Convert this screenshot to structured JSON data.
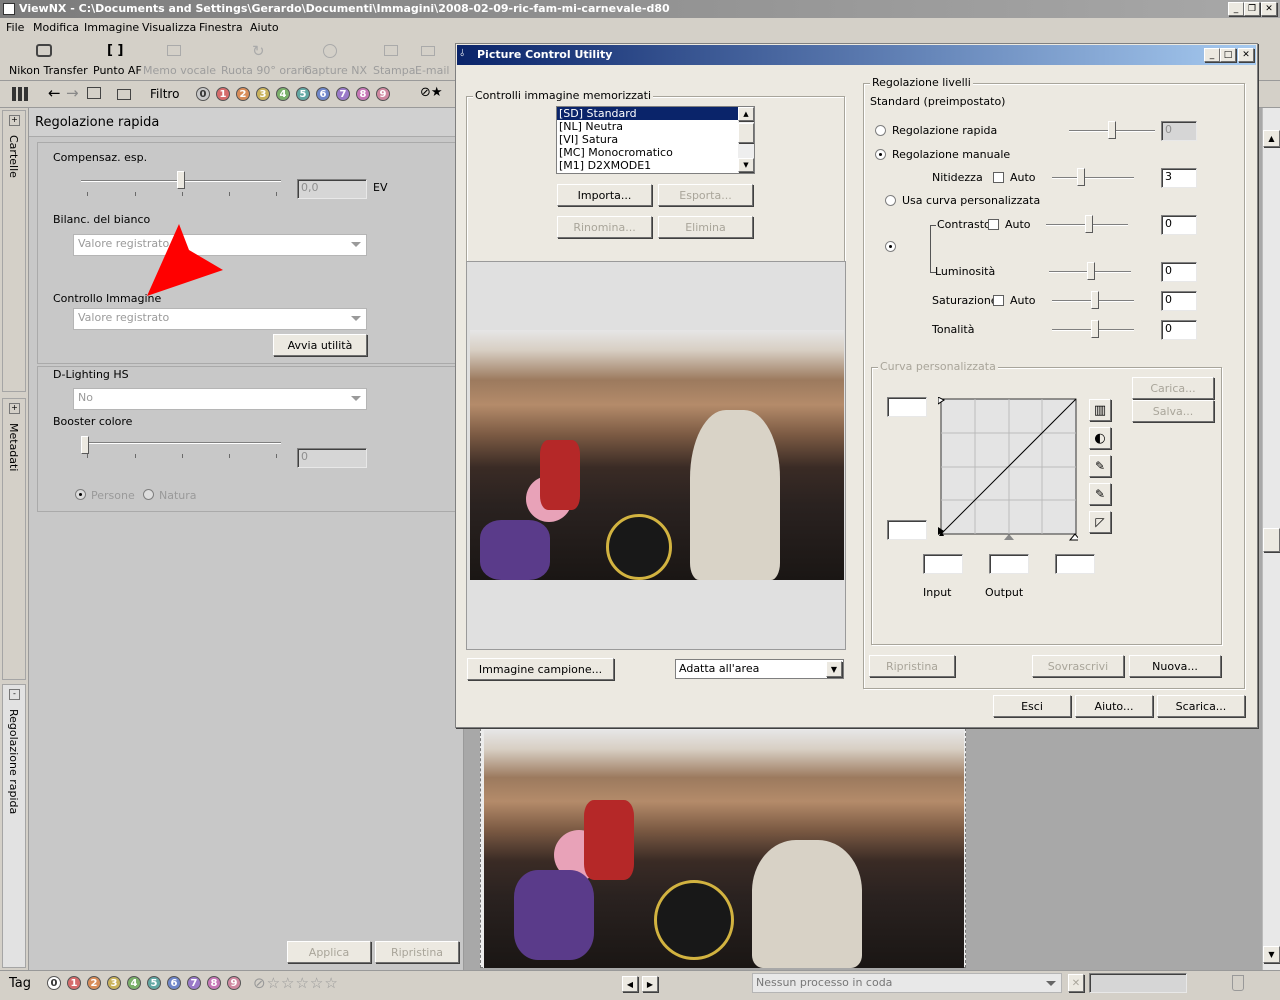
{
  "app": {
    "title": "ViewNX - C:\\Documents and Settings\\Gerardo\\Documenti\\Immagini\\2008-02-09-ric-fam-mi-carnevale-d80",
    "menu": [
      "File",
      "Modifica",
      "Immagine",
      "Visualizza",
      "Finestra",
      "Aiuto"
    ],
    "toolbar": [
      "Nikon Transfer",
      "Punto AF",
      "Memo vocale",
      "Ruota 90° orario",
      "Capture NX",
      "Stampa",
      "E-mail"
    ],
    "filter_label": "Filtro",
    "filter_numbers": [
      "0",
      "1",
      "2",
      "3",
      "4",
      "5",
      "6",
      "7",
      "8",
      "9"
    ]
  },
  "sidebar_tabs": [
    "Cartelle",
    "Metadati",
    "Regolazione rapida"
  ],
  "quick_panel": {
    "title": "Regolazione rapida",
    "exposure_label": "Compensaz. esp.",
    "exposure_value": "0,0",
    "exposure_unit": "EV",
    "wb_label": "Bilanc. del bianco",
    "wb_value": "Valore registrato",
    "picture_control_label": "Controllo Immagine",
    "picture_control_value": "Valore registrato",
    "launch_button": "Avvia utilità",
    "dlighting_label": "D-Lighting HS",
    "dlighting_value": "No",
    "booster_label": "Booster colore",
    "booster_value": "0",
    "radio_people": "Persone",
    "radio_nature": "Natura",
    "apply_button": "Applica",
    "reset_button": "Ripristina"
  },
  "dialog": {
    "title": "Picture Control Utility",
    "stored_group": "Controlli immagine memorizzati",
    "list_items": [
      "[SD] Standard",
      "[NL] Neutra",
      "[VI] Satura",
      "[MC] Monocromatico",
      "[M1] D2XMODE1"
    ],
    "import_button": "Importa...",
    "export_button": "Esporta...",
    "rename_button": "Rinomina...",
    "delete_button": "Elimina",
    "sample_button": "Immagine campione...",
    "fit_value": "Adatta all'area",
    "levels_group": "Regolazione livelli",
    "levels_subtitle": "Standard (preimpostato)",
    "quick_radio": "Regolazione rapida",
    "quick_value": "0",
    "manual_radio": "Regolazione manuale",
    "sharpness_label": "Nitidezza",
    "auto_label": "Auto",
    "sharpness_value": "3",
    "custom_curve_radio": "Usa curva personalizzata",
    "contrast_label": "Contrasto",
    "contrast_value": "0",
    "brightness_label": "Luminosità",
    "brightness_value": "0",
    "saturation_label": "Saturazione",
    "saturation_value": "0",
    "hue_label": "Tonalità",
    "hue_value": "0",
    "curve_group": "Curva personalizzata",
    "load_button": "Carica...",
    "save_button": "Salva...",
    "input_label": "Input",
    "output_label": "Output",
    "reset_button": "Ripristina",
    "overwrite_button": "Sovrascrivi",
    "new_button": "Nuova...",
    "exit_button": "Esci",
    "help_button": "Aiuto...",
    "download_button": "Scarica..."
  },
  "statusbar": {
    "tag_label": "Tag",
    "tag_numbers": [
      "0",
      "1",
      "2",
      "3",
      "4",
      "5",
      "6",
      "7",
      "8",
      "9"
    ],
    "queue_text": "Nessun processo in coda"
  },
  "colors": {
    "dialog_bg": "#ece9e1",
    "titlebar_active": "#0a246a",
    "titlebar_inactive": "#808080",
    "annotation_arrow": "#ff0000"
  }
}
